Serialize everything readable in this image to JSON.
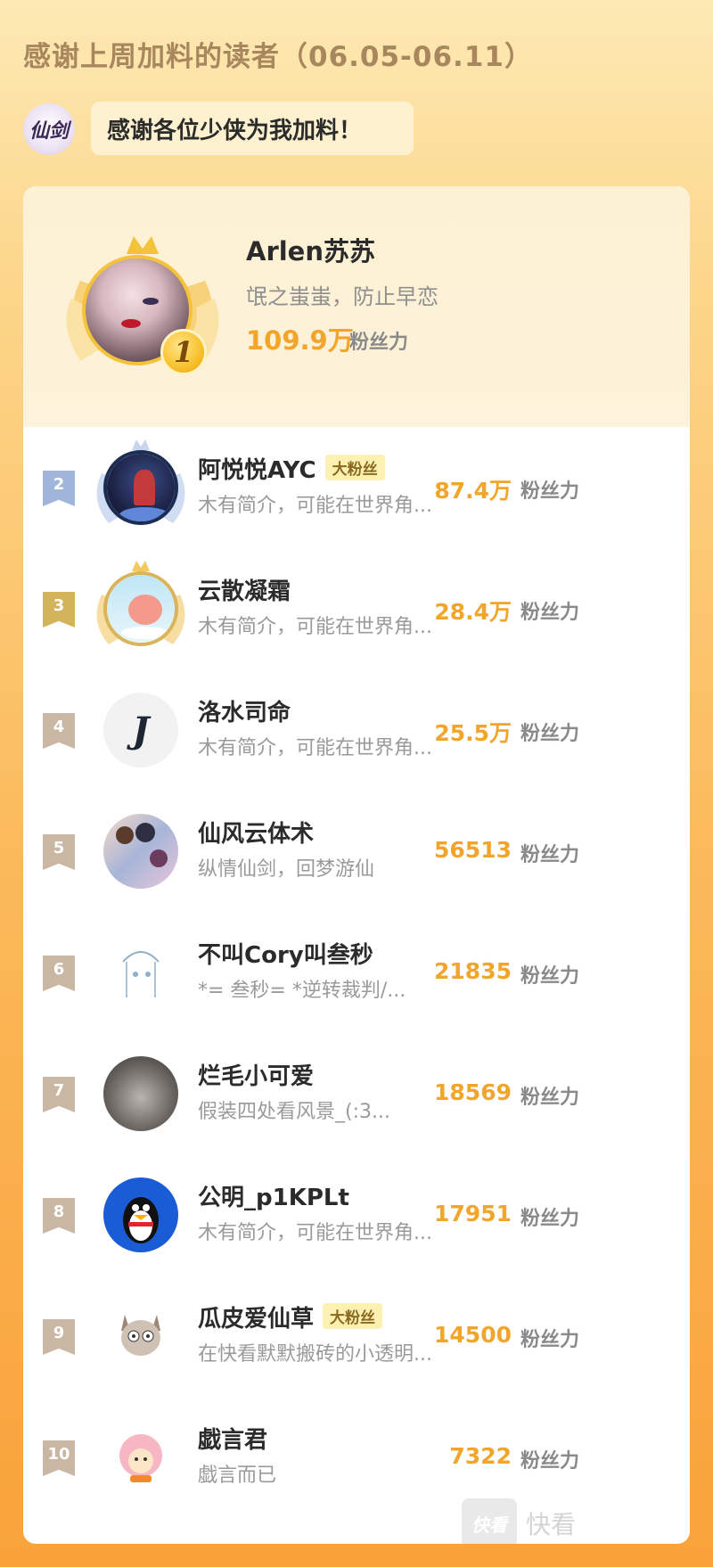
{
  "page": {
    "title": "感谢上周加料的读者（06.05-06.11）",
    "logo_text": "仙剑",
    "thanks_message": "感谢各位少侠为我加料！"
  },
  "top_fan": {
    "rank": "1",
    "name": "Arlen苏苏",
    "bio": "氓之蚩蚩，防止早恋",
    "score": "109.9万",
    "score_unit": "粉丝力"
  },
  "fans": [
    {
      "rank": "2",
      "name": "阿悦悦AYC",
      "badge": "大粉丝",
      "bio": "木有简介，可能在世界角...",
      "score": "87.4万",
      "score_unit": "粉丝力",
      "flag_color": "#9fb6da",
      "avatar_icon": "night-girl-avatar"
    },
    {
      "rank": "3",
      "name": "云散凝霜",
      "badge": "",
      "bio": "木有简介，可能在世界角...",
      "score": "28.4万",
      "score_unit": "粉丝力",
      "flag_color": "#d4b45a",
      "avatar_icon": "pink-dragon-avatar"
    },
    {
      "rank": "4",
      "name": "洛水司命",
      "badge": "",
      "bio": "木有简介，可能在世界角...",
      "score": "25.5万",
      "score_unit": "粉丝力",
      "flag_color": "#c9b6a3",
      "avatar_icon": "ink-calligraphy-avatar"
    },
    {
      "rank": "5",
      "name": "仙风云体术",
      "badge": "",
      "bio": "纵情仙剑，回梦游仙",
      "score": "56513",
      "score_unit": "粉丝力",
      "flag_color": "#c9b6a3",
      "avatar_icon": "anime-group-avatar"
    },
    {
      "rank": "6",
      "name": "不叫Cory叫叁秒",
      "badge": "",
      "bio": "*= 叁秒= *逆转裁判/...",
      "score": "21835",
      "score_unit": "粉丝力",
      "flag_color": "#c9b6a3",
      "avatar_icon": "sketch-girl-avatar"
    },
    {
      "rank": "7",
      "name": "烂毛小可爱",
      "badge": "",
      "bio": "假装四处看风景_(:3...",
      "score": "18569",
      "score_unit": "粉丝力",
      "flag_color": "#c9b6a3",
      "avatar_icon": "cat-avatar"
    },
    {
      "rank": "8",
      "name": "公明_p1KPLt",
      "badge": "",
      "bio": "木有简介，可能在世界角...",
      "score": "17951",
      "score_unit": "粉丝力",
      "flag_color": "#c9b6a3",
      "avatar_icon": "penguin-avatar"
    },
    {
      "rank": "9",
      "name": "瓜皮爱仙草",
      "badge": "大粉丝",
      "bio": "在快看默默搬砖的小透明...",
      "score": "14500",
      "score_unit": "粉丝力",
      "flag_color": "#c9b6a3",
      "avatar_icon": "cartoon-cat-avatar"
    },
    {
      "rank": "10",
      "name": "戯言君",
      "badge": "",
      "bio": "戯言而已",
      "score": "7322",
      "score_unit": "粉丝力",
      "flag_color": "#c9b6a3",
      "avatar_icon": "pink-sheep-avatar"
    }
  ],
  "watermark": {
    "box_text": "快看",
    "text": "快看"
  }
}
